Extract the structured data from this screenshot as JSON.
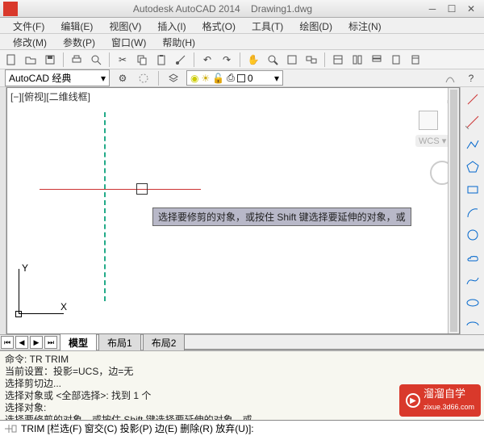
{
  "title_app": "Autodesk AutoCAD 2014",
  "title_doc": "Drawing1.dwg",
  "menu1": [
    "文件(F)",
    "编辑(E)",
    "视图(V)",
    "插入(I)",
    "格式(O)",
    "工具(T)",
    "绘图(D)",
    "标注(N)"
  ],
  "menu2": [
    "修改(M)",
    "参数(P)",
    "窗口(W)",
    "帮助(H)"
  ],
  "workspace": "AutoCAD 经典",
  "layer_zero": "0",
  "canvas_view_label": "[−][俯视][二维线框]",
  "wcs_label": "WCS",
  "ucs_y": "Y",
  "ucs_x": "X",
  "tooltip_text": "选择要修剪的对象，或按住 Shift 键选择要延伸的对象，或",
  "tabs": {
    "model": "模型",
    "layout1": "布局1",
    "layout2": "布局2"
  },
  "cmd_history": [
    "命令:  TR TRIM",
    "当前设置：投影=UCS，边=无",
    "选择剪切边...",
    "选择对象或 <全部选择>:  找到 1 个",
    "选择对象:",
    "选择要修剪的对象，或按住 Shift 键选择要延伸的对象，或"
  ],
  "cmdline_text": "TRIM [栏选(F) 窗交(C) 投影(P) 边(E) 删除(R) 放弃(U)]:",
  "logo_text": "溜溜自学",
  "logo_url": "zixue.3d66.com",
  "chart_data": null
}
